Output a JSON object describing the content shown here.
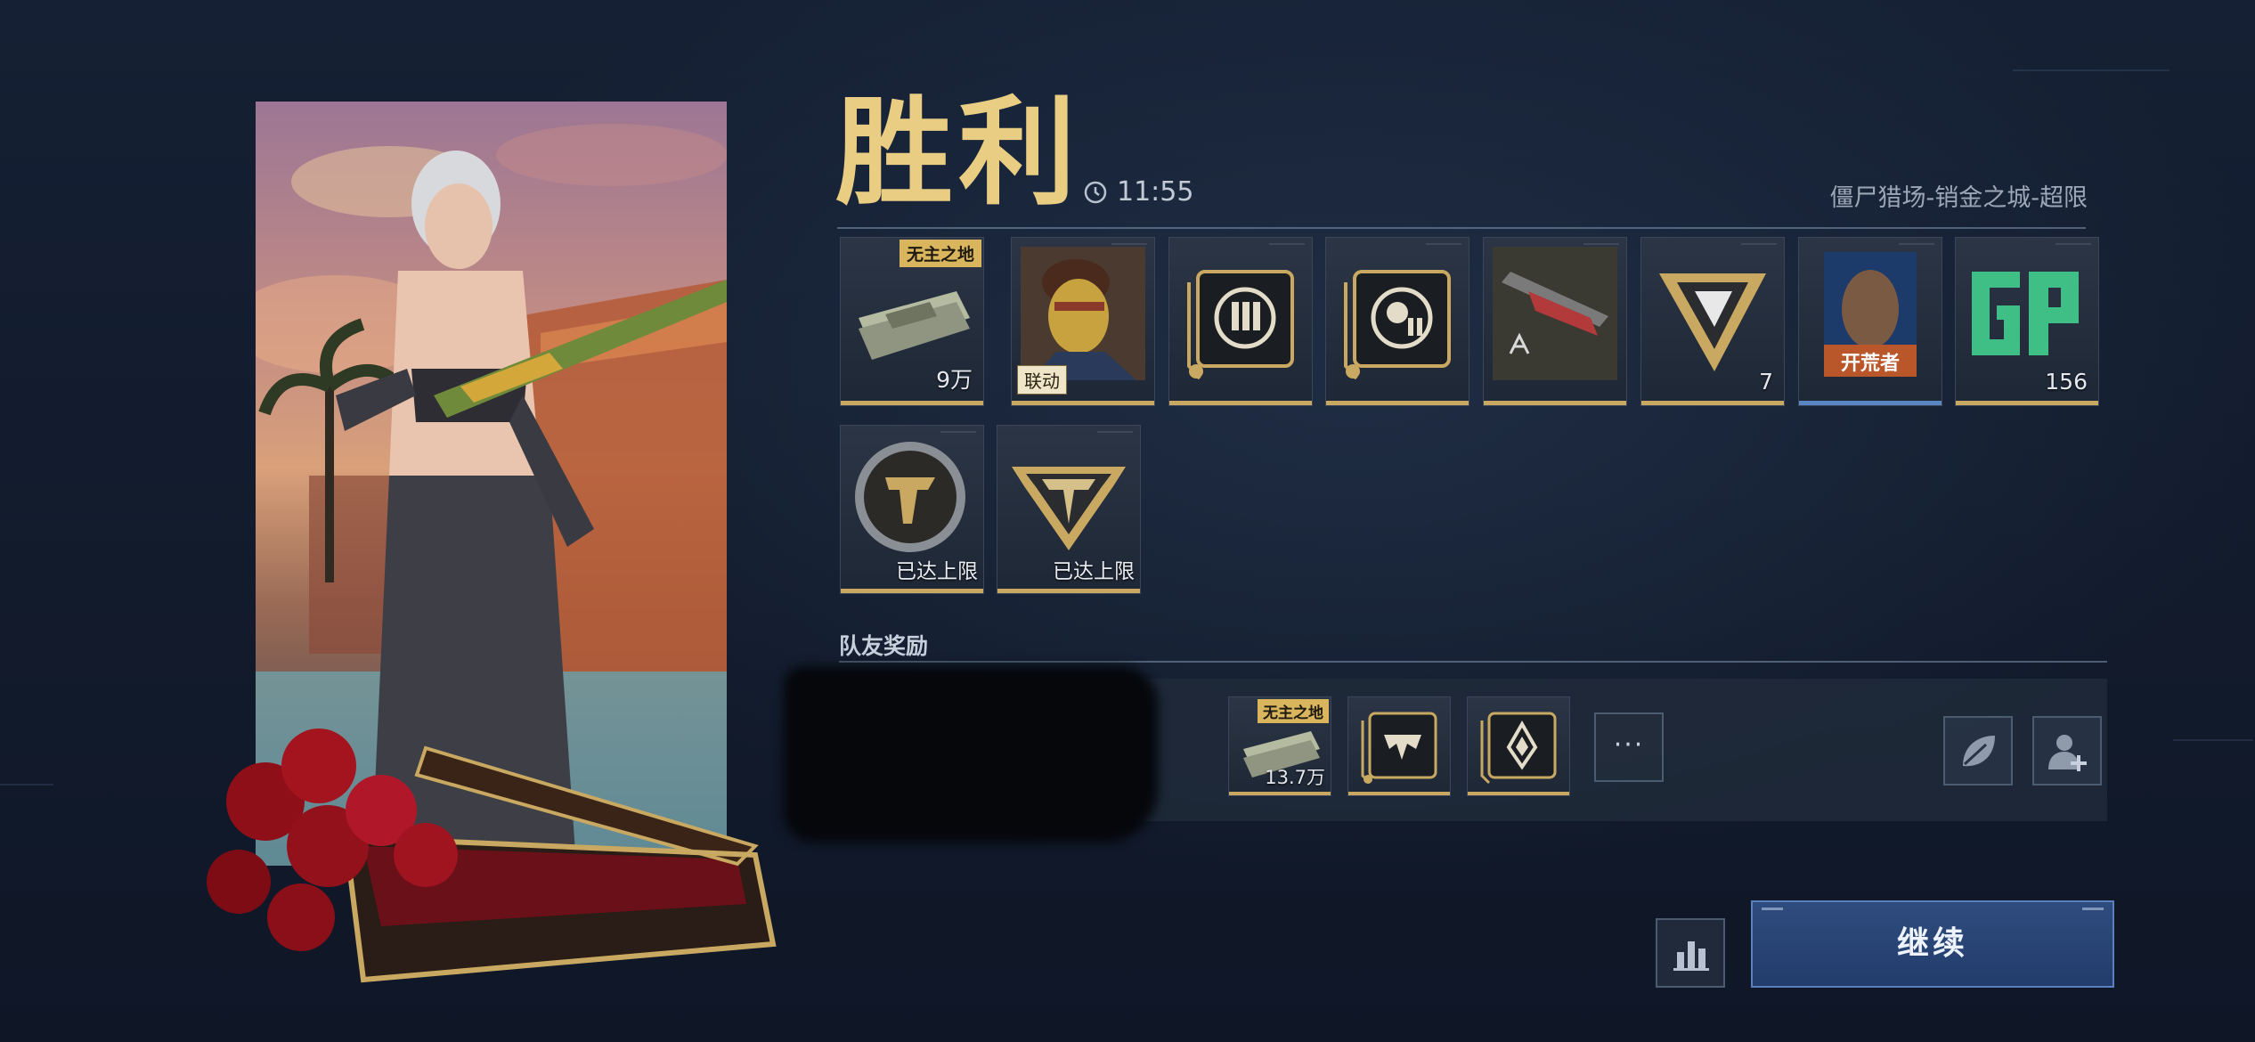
{
  "header": {
    "title": "胜利",
    "time": "11:55",
    "mode": "僵尸猎场-销金之城-超限"
  },
  "rewards": [
    {
      "name": "cash-bundle",
      "tag": "无主之地",
      "qty": "9万",
      "icon": "cash-stack-icon"
    },
    {
      "name": "character-card",
      "badge": "联动",
      "icon": "character-portrait-icon"
    },
    {
      "name": "ammo-upgrade-card",
      "icon": "ammo-crest-icon"
    },
    {
      "name": "tech-upgrade-card",
      "icon": "skull-gear-icon"
    },
    {
      "name": "weapon-blueprint",
      "icon": "weapon-blueprint-icon"
    },
    {
      "name": "triangle-token",
      "qty": "7",
      "icon": "triangle-emblem-icon"
    },
    {
      "name": "pioneer-card",
      "label": "开荒者",
      "icon": "pioneer-poster-icon"
    },
    {
      "name": "gp-points",
      "qty": "156",
      "icon": "gp-icon"
    },
    {
      "name": "coin-emblem",
      "cap": "已达上限",
      "icon": "round-emblem-icon"
    },
    {
      "name": "shield-emblem",
      "cap": "已达上限",
      "icon": "shield-emblem-icon"
    }
  ],
  "teammates": {
    "label": "队友奖励",
    "items": [
      {
        "tag": "无主之地",
        "qty": "13.7万",
        "icon": "cash-stack-icon"
      },
      {
        "icon": "monster-crest-icon"
      },
      {
        "icon": "drop-crest-icon"
      }
    ],
    "more": "···"
  },
  "buttons": {
    "continue": "继续"
  },
  "colors": {
    "gold": "#e8cd82",
    "tag_gold": "#d9b65d",
    "accent_blue": "#2f4c7e",
    "background": "#152034"
  }
}
